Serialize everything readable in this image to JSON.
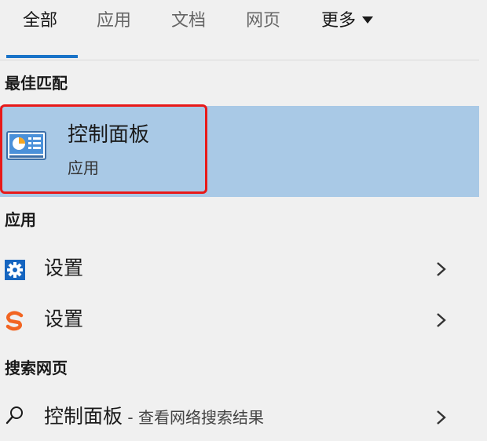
{
  "tabs": [
    {
      "label": "全部"
    },
    {
      "label": "应用"
    },
    {
      "label": "文档"
    },
    {
      "label": "网页"
    },
    {
      "label": "更多"
    }
  ],
  "sections": {
    "best_match": "最佳匹配",
    "apps": "应用",
    "web": "搜索网页"
  },
  "best_match": {
    "title": "控制面板",
    "subtitle": "应用",
    "icon": "control-panel-icon"
  },
  "apps": [
    {
      "label": "设置",
      "icon": "gear-icon"
    },
    {
      "label": "设置",
      "icon": "sogou-icon"
    }
  ],
  "web": {
    "query": "控制面板",
    "suffix": " - 查看网络搜索结果",
    "icon": "search-icon"
  },
  "colors": {
    "accent": "#1a73c8",
    "highlight": "#a9c9e6",
    "annotation_red": "#e81919",
    "sogou_orange": "#f26522",
    "gear_blue": "#1565c0"
  }
}
